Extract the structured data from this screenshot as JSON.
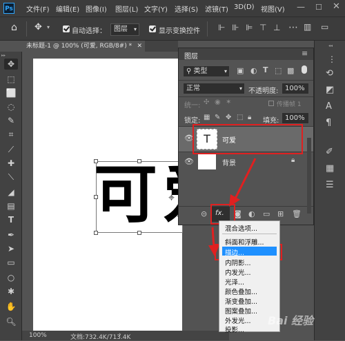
{
  "menubar": {
    "logo": "Ps",
    "items": [
      "文件(F)",
      "编辑(E)",
      "图像(I)",
      "图层(L)",
      "文字(Y)",
      "选择(S)",
      "滤镜(T)",
      "3D(D)",
      "视图(V)"
    ]
  },
  "options": {
    "auto_select_label": "自动选择：",
    "auto_select_value": "图层",
    "show_transform_label": "显示变换控件"
  },
  "document": {
    "tab_title": "未标题-1 @ 100% (可爱, RGB/8#) *",
    "canvas_text": "可爱",
    "zoom": "100%",
    "status": "文档:732.4K/713.4K"
  },
  "layers_panel": {
    "title": "图层",
    "filter_type": "类型",
    "blend_mode": "正常",
    "opacity_label": "不透明度:",
    "opacity_value": "100%",
    "unify_label": "统一:",
    "propagate_label": "传播帧 1",
    "lock_label": "锁定:",
    "fill_label": "填充:",
    "fill_value": "100%",
    "layers": [
      {
        "name": "可爱",
        "thumb": "T",
        "selected": true
      },
      {
        "name": "背景",
        "thumb": "",
        "selected": false
      }
    ],
    "fx_label": "fx."
  },
  "context_menu": {
    "items": [
      "混合选项...",
      "斜面和浮雕...",
      "描边...",
      "内阴影...",
      "内发光...",
      "光泽...",
      "颜色叠加...",
      "渐变叠加...",
      "图案叠加...",
      "外发光...",
      "投影..."
    ],
    "highlighted_index": 2
  },
  "watermark": "Bai 经验",
  "colors": {
    "highlight": "#1e90ff",
    "annotation": "#e02020",
    "menubar": "#3c3c3c",
    "panel": "#535353"
  }
}
